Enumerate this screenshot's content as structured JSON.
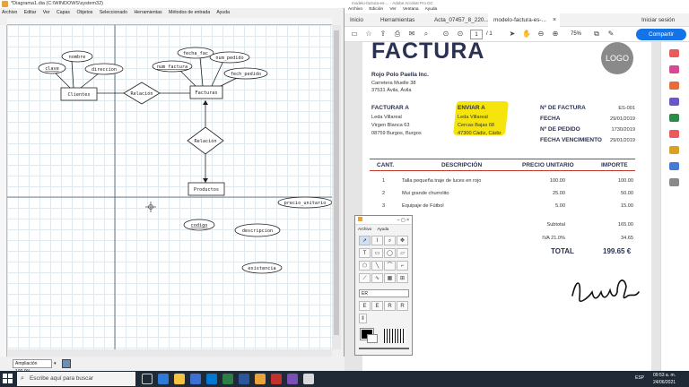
{
  "dia": {
    "title": "*Diagrama1.dia (C:\\WINDOWS\\system32)",
    "menu": [
      "Archivo",
      "Editar",
      "Ver",
      "Capas",
      "Objetos",
      "Seleccionado",
      "Herramientas",
      "Métodos de entrada",
      "Ayuda"
    ],
    "zoom": "Ampliación 100.0%",
    "entities": [
      "Clientes",
      "Facturas",
      "Productos"
    ],
    "relations": [
      "Relación",
      "Relación"
    ],
    "attributes": {
      "clave": "clave",
      "nombre": "nombre",
      "direccion": "direccion",
      "fecha_fac": "fecha_fac",
      "num_pedido": "num_pedido",
      "num_factura": "num_factura",
      "fech_pedido": "fech_pedido",
      "precio_unitario": "precio_unitario",
      "codigo": "codigo",
      "descripcion": "descripcion",
      "existencia": "existencia"
    }
  },
  "toolbox": {
    "menu": [
      "Archivo",
      "Ayuda"
    ],
    "sheet": "ER",
    "er_tools": [
      "E",
      "E",
      "R",
      "R"
    ]
  },
  "pdf": {
    "title": "modelo-factura-es-... - Adobe Acrobat Pro DC",
    "menu": [
      "Archivo",
      "Edición",
      "Ver",
      "Ventana",
      "Ayuda"
    ],
    "tabs": [
      "Inicio",
      "Herramientas",
      "Acta_07457_8_220...",
      "modelo-factura-es-..."
    ],
    "sign_in": "Iniciar sesión",
    "page": "1",
    "pages": "/ 1",
    "zoom": "75%",
    "share": "Compartir"
  },
  "invoice": {
    "title": "FACTURA",
    "logo": "LOGO",
    "company": "Rojo Polo Paella Inc.",
    "addr1": "Carretera Muelle 38",
    "addr2": "37531 Ávila, Ávila",
    "bill_to_label": "FACTURAR A",
    "bill_to": [
      "Leda Villareal",
      "Virgen Blanca 63",
      "08759 Burgos, Burgos"
    ],
    "ship_to_label": "ENVIAR A",
    "ship_to": [
      "Leda Villareal",
      "Cercas Bajas 68",
      "47300 Cádiz, Cádiz"
    ],
    "meta_labels": [
      "Nº DE FACTURA",
      "FECHA",
      "Nº DE PEDIDO",
      "FECHA VENCIMIENTO"
    ],
    "meta_values": [
      "ES-001",
      "29/01/2019",
      "1730/2019",
      "29/01/2019"
    ],
    "headers": [
      "CANT.",
      "DESCRIPCIÓN",
      "PRECIO UNITARIO",
      "IMPORTE"
    ],
    "rows": [
      {
        "qty": "1",
        "desc": "Talla pequeña traje de luces en rojo",
        "price": "100.00",
        "amount": "100.00"
      },
      {
        "qty": "2",
        "desc": "Mui grande churrolito",
        "price": "25.00",
        "amount": "50.00"
      },
      {
        "qty": "3",
        "desc": "Equipaje de Fútbol",
        "price": "5.00",
        "amount": "15.00"
      }
    ],
    "subtotal_label": "Subtotal",
    "subtotal": "165.00",
    "iva_label": "IVA 21.0%",
    "iva": "34.65",
    "total_label": "TOTAL",
    "total": "199.65 €",
    "signature": "Laura García"
  },
  "taskbar": {
    "search_placeholder": "Escribe aquí para buscar",
    "time": "09:53 a. m.",
    "date": "24/06/2021",
    "lang": "ESP"
  }
}
